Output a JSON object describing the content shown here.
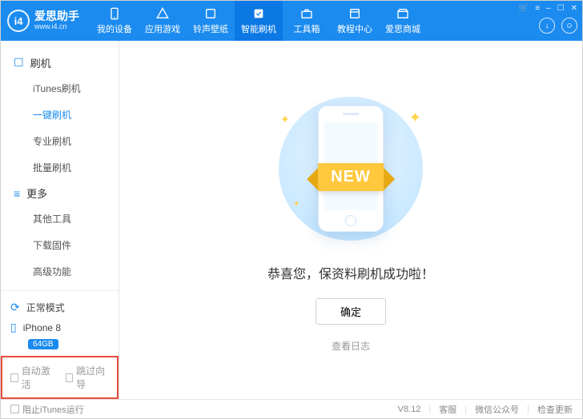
{
  "app": {
    "name": "爱思助手",
    "url": "www.i4.cn",
    "logo_mark": "i4"
  },
  "top_tabs": [
    {
      "id": "devices",
      "label": "我的设备"
    },
    {
      "id": "apps",
      "label": "应用游戏"
    },
    {
      "id": "ring",
      "label": "铃声壁纸"
    },
    {
      "id": "flash",
      "label": "智能刷机"
    },
    {
      "id": "tools",
      "label": "工具箱"
    },
    {
      "id": "tutorial",
      "label": "教程中心"
    },
    {
      "id": "store",
      "label": "爱思商城"
    }
  ],
  "sidebar": {
    "groups": [
      {
        "header": "刷机",
        "items": [
          {
            "label": "iTunes刷机",
            "active": false
          },
          {
            "label": "一键刷机",
            "active": true
          },
          {
            "label": "专业刷机",
            "active": false
          },
          {
            "label": "批量刷机",
            "active": false
          }
        ]
      },
      {
        "header": "更多",
        "items": [
          {
            "label": "其他工具",
            "active": false
          },
          {
            "label": "下载固件",
            "active": false
          },
          {
            "label": "高级功能",
            "active": false
          }
        ]
      }
    ],
    "status": {
      "mode": "正常模式",
      "device": "iPhone 8",
      "storage": "64GB"
    },
    "options": {
      "auto_activate": "自动激活",
      "skip_guide": "跳过向导"
    }
  },
  "main": {
    "ribbon": "NEW",
    "success_msg": "恭喜您，保资料刷机成功啦！",
    "confirm_label": "确定",
    "log_label": "查看日志"
  },
  "footer": {
    "block_itunes": "阻止iTunes运行",
    "version": "V8.12",
    "links": {
      "service": "客服",
      "wechat": "微信公众号",
      "update": "检查更新"
    }
  }
}
